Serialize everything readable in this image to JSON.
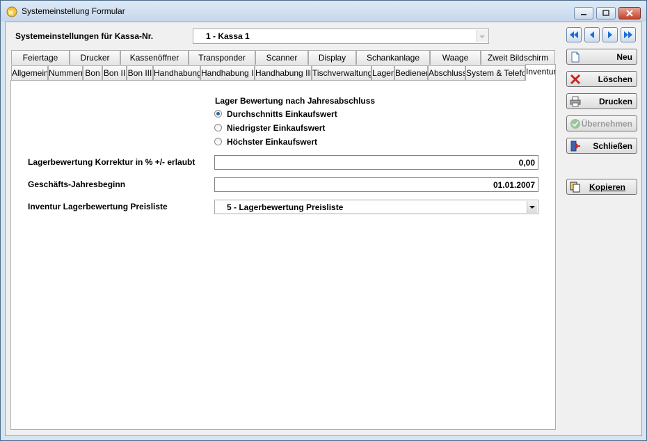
{
  "window": {
    "title": "Systemeinstellung Formular"
  },
  "header": {
    "label": "Systemeinstellungen für Kassa-Nr.",
    "kassa_value": "1 - Kassa 1"
  },
  "tabs_row1": [
    "Feiertage",
    "Drucker",
    "Kassenöffner",
    "Transponder",
    "Scanner",
    "Display",
    "Schankanlage",
    "Waage",
    "Zweit Bildschirm"
  ],
  "tabs_row2": [
    "Allgemein",
    "Nummern",
    "Bon",
    "Bon II",
    "Bon III",
    "Handhabung",
    "Handhabung II",
    "Handhabung III",
    "Tischverwaltung",
    "Lager",
    "Bediener",
    "Abschluss",
    "System & Telefon",
    "Inventur"
  ],
  "active_tab": "Inventur",
  "inventur": {
    "group_title": "Lager Bewertung nach Jahresabschluss",
    "options": [
      {
        "label": "Durchschnitts Einkaufswert",
        "checked": true
      },
      {
        "label": "Niedrigster Einkaufswert",
        "checked": false
      },
      {
        "label": "Höchster Einkaufswert",
        "checked": false
      }
    ],
    "korrektur_label": "Lagerbewertung Korrektur in % +/- erlaubt",
    "korrektur_value": "0,00",
    "jahresbeginn_label": "Geschäfts-Jahresbeginn",
    "jahresbeginn_value": "01.01.2007",
    "preisliste_label": "Inventur Lagerbewertung Preisliste",
    "preisliste_value": "5 - Lagerbewertung Preisliste"
  },
  "sidebar": {
    "neu": "Neu",
    "loeschen": "Löschen",
    "drucken": "Drucken",
    "uebernehmen": "Übernehmen",
    "schliessen": "Schließen",
    "kopieren": "Kopieren"
  },
  "colors": {
    "accent": "#2a62a8",
    "delete": "#d42020"
  }
}
